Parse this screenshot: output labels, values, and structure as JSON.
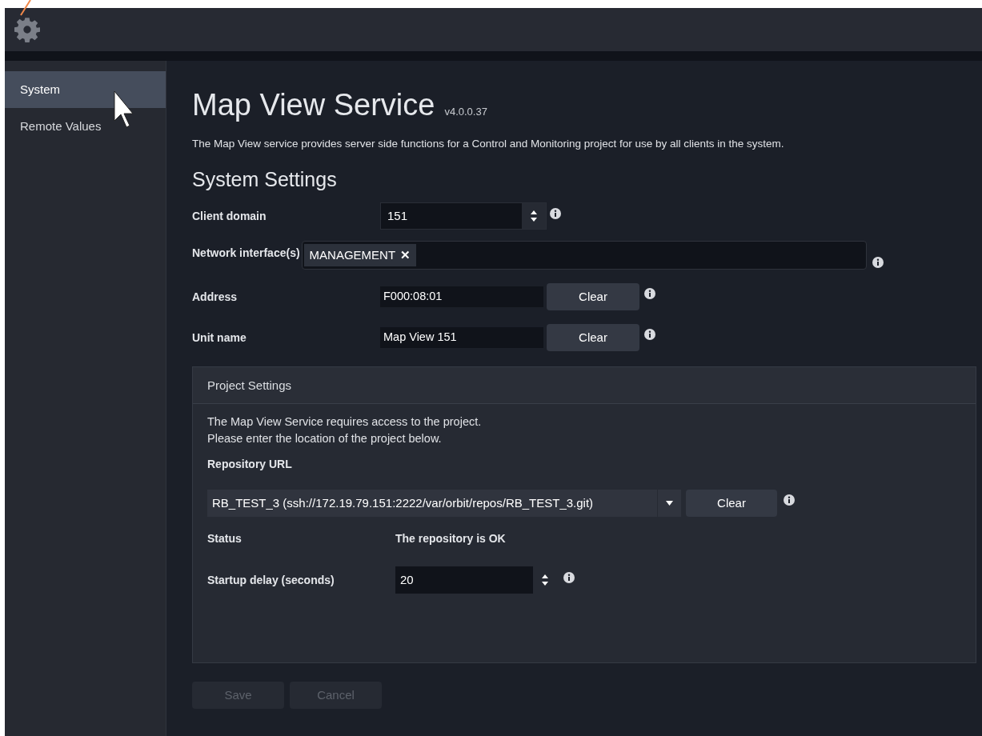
{
  "sidebar": {
    "items": [
      {
        "label": "System",
        "selected": true
      },
      {
        "label": "Remote Values",
        "selected": false
      }
    ]
  },
  "header": {
    "title": "Map View Service",
    "version": "v4.0.0.37",
    "description": "The Map View service provides server side functions for a Control and Monitoring project for use by all clients in the system."
  },
  "system_settings": {
    "title": "System Settings",
    "client_domain": {
      "label": "Client domain",
      "value": "151"
    },
    "network_interfaces": {
      "label": "Network interface(s)",
      "tags": [
        "MANAGEMENT"
      ],
      "remove_glyph": "✕"
    },
    "address": {
      "label": "Address",
      "value": "F000:08:01",
      "button": "Clear"
    },
    "unit_name": {
      "label": "Unit name",
      "value": "Map View 151",
      "button": "Clear"
    }
  },
  "project_settings": {
    "title": "Project Settings",
    "note": "The Map View Service requires access to the project. Please enter the location of the project below.",
    "repository_label": "Repository URL",
    "repository_value": "RB_TEST_3 (ssh://172.19.79.151:2222/var/orbit/repos/RB_TEST_3.git)",
    "repository_button": "Clear",
    "status_label": "Status",
    "status_value": "The repository is OK",
    "startup_delay": {
      "label": "Startup delay (seconds)",
      "value": "20"
    }
  },
  "buttons": [
    {
      "label": "Save",
      "disabled": true
    },
    {
      "label": "Cancel",
      "disabled": true
    }
  ]
}
